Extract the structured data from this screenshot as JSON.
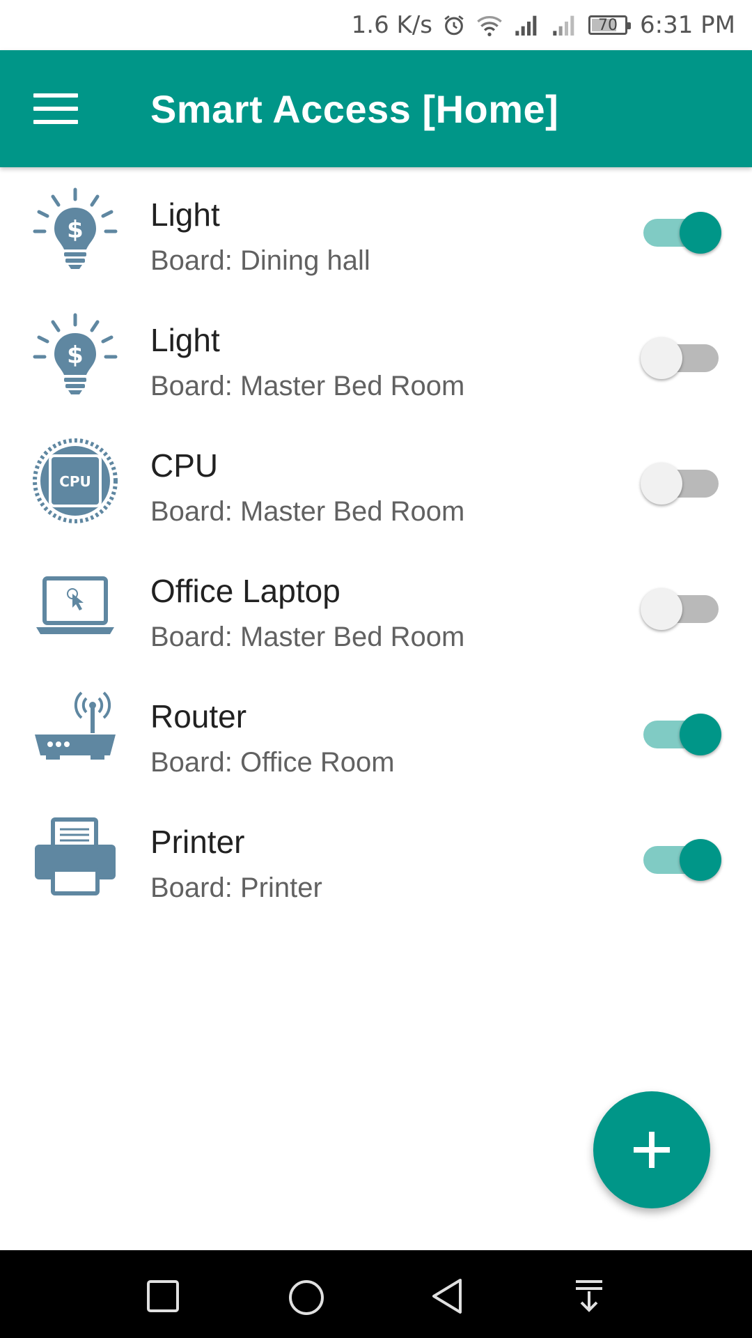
{
  "status_bar": {
    "speed": "1.6 K/s",
    "battery": "70",
    "battery_level": 0.7,
    "time": "6:31 PM",
    "icons": [
      "alarm-icon",
      "wifi-icon",
      "signal-icon",
      "signal-weak-icon",
      "battery-icon"
    ]
  },
  "app_bar": {
    "title": "Smart Access [Home]",
    "menu_icon": "hamburger-menu-icon"
  },
  "devices": [
    {
      "name": "Light",
      "board": "Board: Dining hall",
      "icon": "lightbulb-icon",
      "on": true
    },
    {
      "name": "Light",
      "board": "Board: Master Bed Room",
      "icon": "lightbulb-icon",
      "on": false
    },
    {
      "name": "CPU",
      "board": "Board: Master Bed Room",
      "icon": "cpu-icon",
      "on": false
    },
    {
      "name": "Office Laptop",
      "board": "Board: Master Bed Room",
      "icon": "laptop-icon",
      "on": false
    },
    {
      "name": "Router",
      "board": "Board: Office Room",
      "icon": "router-icon",
      "on": true
    },
    {
      "name": "Printer",
      "board": "Board: Printer",
      "icon": "printer-icon",
      "on": true
    }
  ],
  "fab": {
    "icon": "plus-icon"
  },
  "nav_bar": {
    "icons": [
      "recents-icon",
      "home-icon",
      "back-icon",
      "notification-pull-icon"
    ]
  },
  "colors": {
    "primary": "#009688",
    "primary_light": "#80cbc4",
    "icon": "#5f87a1",
    "switch_off_track": "#b9b9b9"
  }
}
